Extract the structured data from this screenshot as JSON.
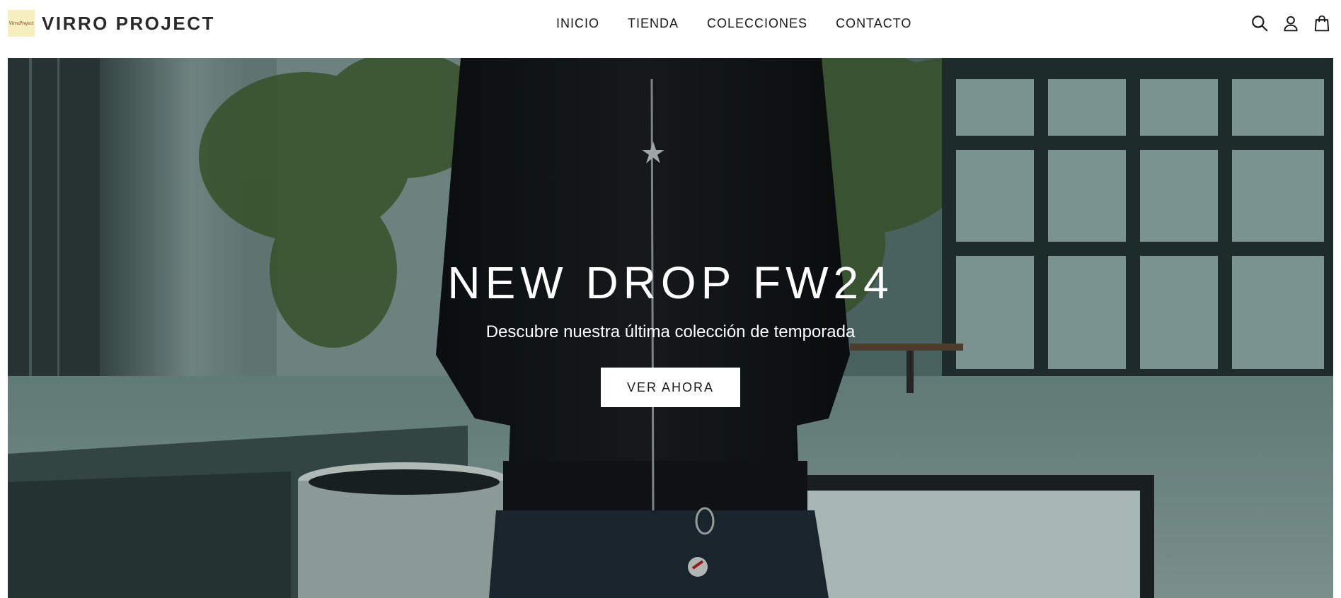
{
  "header": {
    "logo_text": "VirroProject",
    "brand_name": "VIRRO PROJECT",
    "nav": [
      {
        "label": "INICIO"
      },
      {
        "label": "TIENDA"
      },
      {
        "label": "COLECCIONES"
      },
      {
        "label": "CONTACTO"
      }
    ],
    "icons": [
      "search-icon",
      "account-icon",
      "cart-icon"
    ]
  },
  "hero": {
    "title": "NEW DROP FW24",
    "subtitle": "Descubre nuestra última colección de temporada",
    "cta_label": "VER AHORA"
  },
  "colors": {
    "header_bg": "#ffffff",
    "text_dark": "#1a1a1a",
    "hero_tint": "#4d6462",
    "logo_bg": "#f7efbe"
  }
}
